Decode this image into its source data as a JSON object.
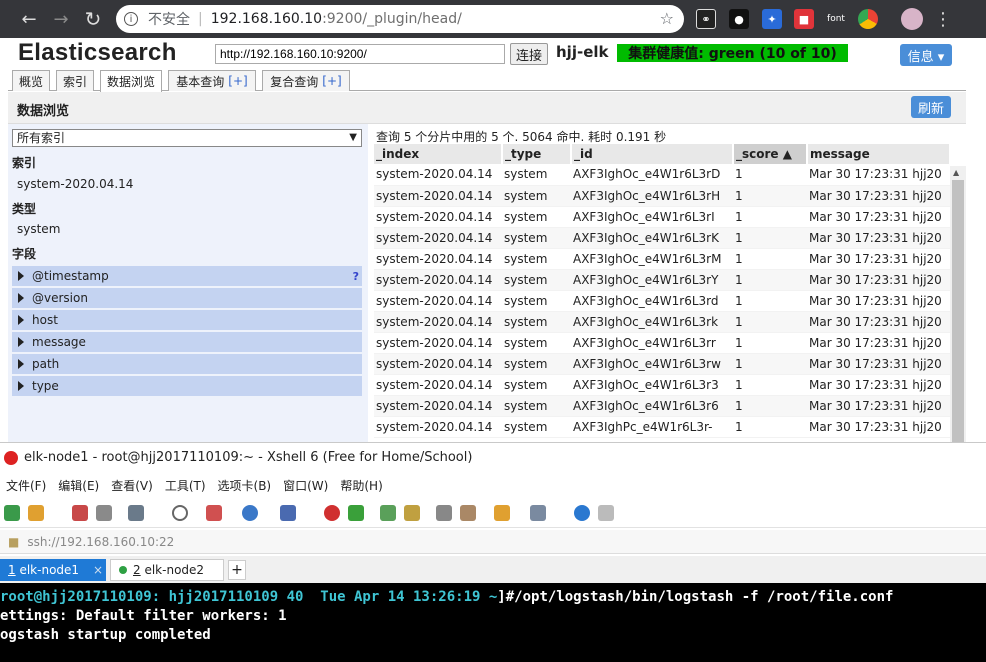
{
  "browser": {
    "insecure_label": "不安全",
    "url_host": "192.168.160.10",
    "url_path": ":9200/_plugin/head/",
    "ext_font": "font"
  },
  "es": {
    "title": "Elasticsearch",
    "connect_url": "http://192.168.160.10:9200/",
    "connect_label": "连接",
    "cluster_name": "hjj-elk",
    "health": "集群健康值: green (10 of 10)",
    "info_label": "信息 ▾",
    "tabs": [
      {
        "label": "概览",
        "plus": ""
      },
      {
        "label": "索引",
        "plus": ""
      },
      {
        "label": "数据浏览",
        "plus": ""
      },
      {
        "label": "基本查询",
        "plus": "[+]"
      },
      {
        "label": "复合查询",
        "plus": "[+]"
      }
    ],
    "subtitle": "数据浏览",
    "refresh_label": "刷新",
    "sidebar": {
      "select_value": "所有索引",
      "index_heading": "索引",
      "index_value": "system-2020.04.14",
      "type_heading": "类型",
      "type_value": "system",
      "fields_heading": "字段",
      "fields": [
        "@timestamp",
        "@version",
        "host",
        "message",
        "path",
        "type"
      ],
      "help_mark": "?"
    },
    "results": {
      "summary": "查询 5 个分片中用的 5 个. 5064 命中. 耗时 0.191 秒",
      "columns": [
        "_index",
        "_type",
        "_id",
        "_score ▲",
        "message"
      ],
      "rows": [
        [
          "system-2020.04.14",
          "system",
          "AXF3IghOc_e4W1r6L3rD",
          "1",
          "Mar 30 17:23:31 hjj20"
        ],
        [
          "system-2020.04.14",
          "system",
          "AXF3IghOc_e4W1r6L3rH",
          "1",
          "Mar 30 17:23:31 hjj20"
        ],
        [
          "system-2020.04.14",
          "system",
          "AXF3IghOc_e4W1r6L3rI",
          "1",
          "Mar 30 17:23:31 hjj20"
        ],
        [
          "system-2020.04.14",
          "system",
          "AXF3IghOc_e4W1r6L3rK",
          "1",
          "Mar 30 17:23:31 hjj20"
        ],
        [
          "system-2020.04.14",
          "system",
          "AXF3IghOc_e4W1r6L3rM",
          "1",
          "Mar 30 17:23:31 hjj20"
        ],
        [
          "system-2020.04.14",
          "system",
          "AXF3IghOc_e4W1r6L3rY",
          "1",
          "Mar 30 17:23:31 hjj20"
        ],
        [
          "system-2020.04.14",
          "system",
          "AXF3IghOc_e4W1r6L3rd",
          "1",
          "Mar 30 17:23:31 hjj20"
        ],
        [
          "system-2020.04.14",
          "system",
          "AXF3IghOc_e4W1r6L3rk",
          "1",
          "Mar 30 17:23:31 hjj20"
        ],
        [
          "system-2020.04.14",
          "system",
          "AXF3IghOc_e4W1r6L3rr",
          "1",
          "Mar 30 17:23:31 hjj20"
        ],
        [
          "system-2020.04.14",
          "system",
          "AXF3IghOc_e4W1r6L3rw",
          "1",
          "Mar 30 17:23:31 hjj20"
        ],
        [
          "system-2020.04.14",
          "system",
          "AXF3IghOc_e4W1r6L3r3",
          "1",
          "Mar 30 17:23:31 hjj20"
        ],
        [
          "system-2020.04.14",
          "system",
          "AXF3IghOc_e4W1r6L3r6",
          "1",
          "Mar 30 17:23:31 hjj20"
        ],
        [
          "system-2020.04.14",
          "system",
          "AXF3IghPc_e4W1r6L3r-",
          "1",
          "Mar 30 17:23:31 hjj20"
        ]
      ]
    }
  },
  "xshell": {
    "title": "elk-node1 - root@hjj2017110109:~ - Xshell 6 (Free for Home/School)",
    "menu": [
      "文件(F)",
      "编辑(E)",
      "查看(V)",
      "工具(T)",
      "选项卡(B)",
      "窗口(W)",
      "帮助(H)"
    ],
    "address": "ssh://192.168.160.10:22",
    "tabs": [
      {
        "num": "1",
        "label": "elk-node1"
      },
      {
        "num": "2",
        "label": "elk-node2"
      }
    ],
    "close_mark": "×",
    "add_mark": "+",
    "terminal": {
      "line1_prompt": "root@hjj2017110109: hjj2017110109 40  Tue Apr 14 13:26:19 ~",
      "line1_cmd": "]#/opt/logstash/bin/logstash -f /root/file.conf",
      "line2": "ettings: Default filter workers: 1",
      "line3": "ogstash startup completed"
    }
  },
  "colors": {
    "chrome_bar": "#35363a",
    "health_green": "#00bb00",
    "accent_blue": "#4a8ed8",
    "xshell_tab_active": "#1f7ad6",
    "terminal_bg": "#000000",
    "terminal_prompt": "#3fc5d4"
  }
}
